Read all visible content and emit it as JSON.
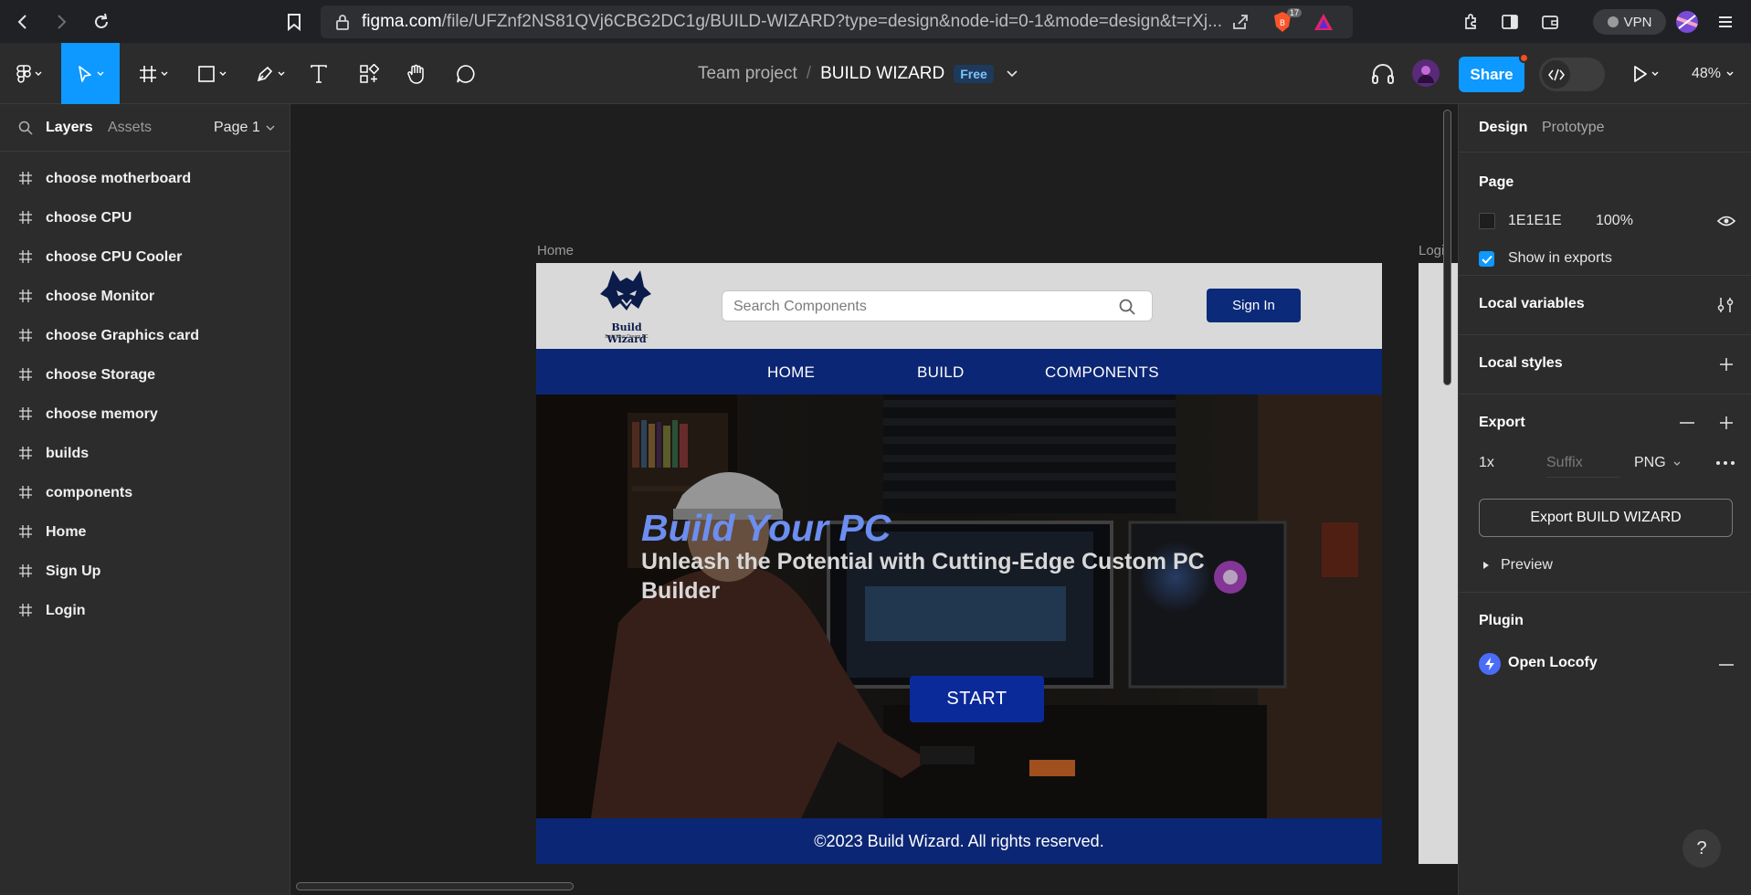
{
  "browser": {
    "url_host": "figma.com",
    "url_path": "/file/UFZnf2NS81QVj6CBG2DC1g/BUILD-WIZARD?type=design&node-id=0-1&mode=design&t=rXj...",
    "brave_count": "17",
    "vpn_label": "VPN"
  },
  "toolbar": {
    "team": "Team project",
    "separator": "/",
    "file_name": "BUILD WIZARD",
    "plan_badge": "Free",
    "share_label": "Share",
    "zoom": "48%"
  },
  "left_panel": {
    "tabs": [
      "Layers",
      "Assets"
    ],
    "page_selector": "Page 1",
    "layers": [
      "choose motherboard",
      "choose CPU",
      "choose CPU Cooler",
      "choose Monitor",
      "choose Graphics card",
      "choose Storage",
      "choose memory",
      "builds",
      "components",
      "Home",
      "Sign Up",
      "Login"
    ]
  },
  "canvas": {
    "frame_home_label": "Home",
    "frame_login_label": "Login",
    "site": {
      "logo_text": "Build Wizard",
      "logo_tagline": "Build Your Dream PC",
      "search_placeholder": "Search Components",
      "signin_label": "Sign In",
      "nav": [
        "HOME",
        "BUILD",
        "COMPONENTS"
      ],
      "hero_title": "Build Your PC",
      "hero_subtitle": "Unleash the Potential with Cutting-Edge Custom PC Builder",
      "start_label": "START",
      "footer": "©2023 Build Wizard. All rights reserved."
    }
  },
  "right_panel": {
    "tabs": [
      "Design",
      "Prototype"
    ],
    "page": {
      "title": "Page",
      "color_hex": "1E1E1E",
      "opacity": "100%",
      "show_in_exports": "Show in exports"
    },
    "local_variables": "Local variables",
    "local_styles": "Local styles",
    "export": {
      "title": "Export",
      "scale": "1x",
      "suffix_placeholder": "Suffix",
      "format": "PNG",
      "button": "Export BUILD WIZARD",
      "preview": "Preview"
    },
    "plugin": {
      "title": "Plugin",
      "name": "Open Locofy"
    },
    "help": "?"
  },
  "colors": {
    "accent": "#0d99ff",
    "site_navy": "#0b2674",
    "hero_title": "#6c8ef0"
  }
}
